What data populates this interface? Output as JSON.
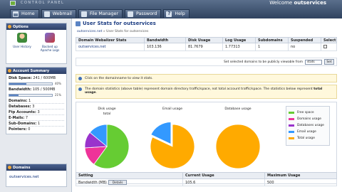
{
  "header": {
    "brand": "CONTROL PANEL",
    "welcome_prefix": "Welcome",
    "username": "outservices",
    "tabs": [
      {
        "label": "Home",
        "icon": "home-icon"
      },
      {
        "label": "Webmail",
        "icon": "mail-icon"
      },
      {
        "label": "File Manager",
        "icon": "folder-icon"
      },
      {
        "label": "Password",
        "icon": "key-icon"
      },
      {
        "label": "Help",
        "icon": "help-icon"
      }
    ]
  },
  "sidebar": {
    "options": {
      "title": "Options",
      "items": [
        {
          "label": "User History",
          "icon": "user-history-icon"
        },
        {
          "label": "Backed up Apache Logs",
          "icon": "apache-logs-icon"
        }
      ]
    },
    "summary": {
      "title": "Account Summary",
      "disk_space": {
        "label": "Disk Space:",
        "value": "241 / 600MB",
        "percent": 40,
        "pct_text": "40%"
      },
      "bandwidth": {
        "label": "Bandwidth:",
        "value": "105 / 500MB",
        "percent": 21,
        "pct_text": "21%"
      },
      "rows": [
        {
          "label": "Domains:",
          "value": "1"
        },
        {
          "label": "Databases:",
          "value": "3"
        },
        {
          "label": "Ftp Accounts:",
          "value": "3"
        },
        {
          "label": "E-Mails:",
          "value": "7"
        },
        {
          "label": "Sub-Domains:",
          "value": "1"
        },
        {
          "label": "Pointers:",
          "value": "0"
        }
      ]
    },
    "domains": {
      "title": "Domains",
      "items": [
        "outservices.net"
      ]
    }
  },
  "main": {
    "title": "User Stats for outservices",
    "breadcrumb": {
      "link": "outservices.net",
      "sep": "»",
      "current": "User Stats for outservices"
    },
    "stats_table": {
      "headers": [
        "Domain Webalizer Stats",
        "Bandwidth",
        "Disk Usage",
        "Log Usage",
        "Subdomains",
        "Suspended",
        "Select"
      ],
      "rows": [
        {
          "domain": "outservices.net",
          "bandwidth": "103.136",
          "disk": "81.7679",
          "log": "1.77313",
          "subdomains": "1",
          "suspended": "no"
        }
      ]
    },
    "public_row": {
      "text": "Set selected domains to be publicly viewable from",
      "input_value": "stats",
      "button": "Set"
    },
    "info1": "Click on the domainname to view it stats.",
    "info2": {
      "text": "The domain statistics (above table) represent domain directory traffic/space, not total account traffic/space. The statistics below represent ",
      "strong": "total usage",
      "end": "."
    },
    "charts": [
      {
        "title": "Disk usage",
        "subtitle": "total",
        "slices": [
          {
            "name": "Free space",
            "value": 60
          },
          {
            "name": "Domains usage",
            "value": 14
          },
          {
            "name": "Databases usage",
            "value": 12
          },
          {
            "name": "Email usage",
            "value": 14
          }
        ]
      },
      {
        "title": "Email usage",
        "subtitle": "",
        "slices": [
          {
            "name": "Total usage",
            "value": 82
          },
          {
            "name": "Email usage",
            "value": 18
          }
        ]
      },
      {
        "title": "Database usage",
        "subtitle": "",
        "slices": [
          {
            "name": "Total usage",
            "value": 100
          }
        ]
      }
    ],
    "legend": [
      {
        "label": "Free space",
        "color": "#66cc33"
      },
      {
        "label": "Domains usage",
        "color": "#ee3399"
      },
      {
        "label": "Databases usage",
        "color": "#9933cc"
      },
      {
        "label": "Email usage",
        "color": "#3399ff"
      },
      {
        "label": "Total usage",
        "color": "#ffaa00"
      }
    ],
    "usage_table": {
      "headers": [
        "Setting",
        "Current Usage",
        "Maximum Usage"
      ],
      "rows": [
        {
          "setting": "Bandwidth (MB)",
          "button": "Details",
          "current": "105.6",
          "max": "500"
        }
      ]
    }
  },
  "colors": {
    "free": "#66cc33",
    "domains": "#ee3399",
    "databases": "#9933cc",
    "email": "#3399ff",
    "total": "#ffaa00"
  }
}
